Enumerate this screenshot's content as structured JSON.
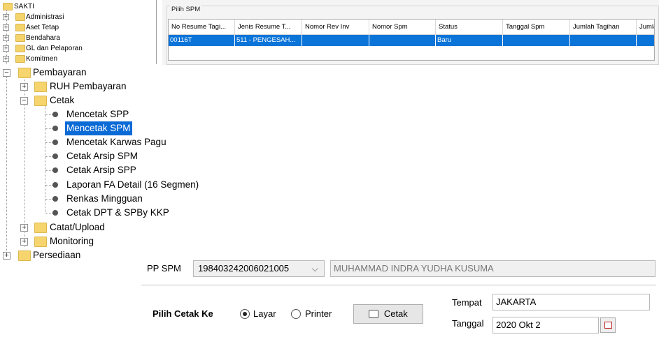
{
  "tree": {
    "root": "SAKTI",
    "top_items": [
      "Administrasi",
      "Aset Tetap",
      "Bendahara",
      "GL dan Pelaporan",
      "Komitmen"
    ],
    "pembayaran": "Pembayaran",
    "ruh": "RUH Pembayaran",
    "cetak": "Cetak",
    "cetak_children": [
      "Mencetak SPP",
      "Mencetak SPM",
      "Mencetak Karwas Pagu",
      "Cetak Arsip SPM",
      "Cetak Arsip SPP",
      "Laporan FA Detail (16 Segmen)",
      "Renkas Mingguan",
      "Cetak DPT & SPBy KKP"
    ],
    "selected_index": 1,
    "after_cetak": [
      "Catat/Upload",
      "Monitoring"
    ],
    "persediaan": "Persediaan",
    "expander_plus": "+",
    "expander_minus": "−"
  },
  "spm": {
    "title": "Pilih SPM",
    "columns": [
      "No Resume Tagi...",
      "Jenis Resume T...",
      "Nomor Rev Inv",
      "Nomor Spm",
      "Status",
      "Tanggal Spm",
      "Jumlah Tagihan",
      "Jumla"
    ],
    "row": [
      "00116T",
      "511 - PENGESAH...",
      "",
      "",
      "Baru",
      "",
      "",
      ""
    ]
  },
  "form": {
    "pp_spm_label": "PP SPM",
    "pp_spm_value": "198403242006021005",
    "pp_spm_name": "MUHAMMAD INDRA YUDHA KUSUMA",
    "pilih_cetak_label": "Pilih Cetak Ke",
    "radio_layar": "Layar",
    "radio_printer": "Printer",
    "cetak_button": "Cetak",
    "tempat_label": "Tempat",
    "tempat_value": "JAKARTA",
    "tanggal_label": "Tanggal",
    "tanggal_value": "2020 Okt 2",
    "chevron": "⌵"
  }
}
